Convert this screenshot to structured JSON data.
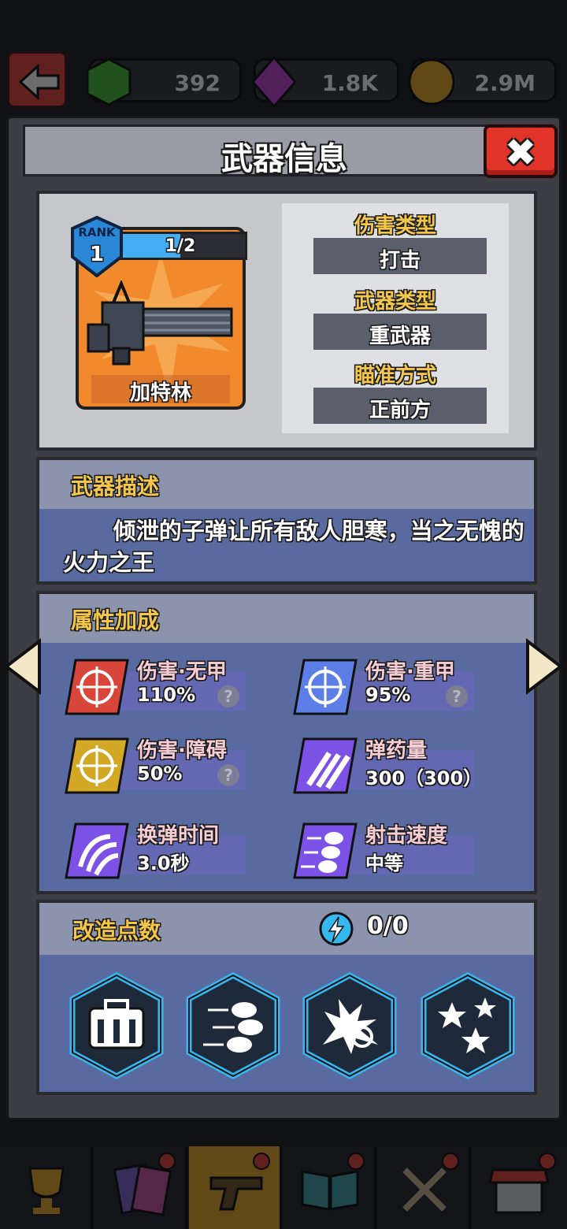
{
  "topbar": {
    "gems_green": "392",
    "gems_purple": "1.8K",
    "coins": "2.9M"
  },
  "header": {
    "title": "武器信息",
    "close_symbol": "✖"
  },
  "weapon": {
    "rank_word": "RANK",
    "rank": "1",
    "rank_progress_text": "1/2",
    "rank_progress_fraction": 0.5,
    "name": "加特林"
  },
  "info": {
    "damage_type_label": "伤害类型",
    "damage_type": "打击",
    "weapon_type_label": "武器类型",
    "weapon_type": "重武器",
    "aim_label": "瞄准方式",
    "aim": "正前方"
  },
  "description": {
    "title": "武器描述",
    "text": "倾泄的子弹让所有敌人胆寒，当之无愧的火力之王"
  },
  "attributes": {
    "title": "属性加成",
    "items": [
      {
        "name": "伤害·无甲",
        "value": "110%",
        "help": "?"
      },
      {
        "name": "伤害·重甲",
        "value": "95%",
        "help": "?"
      },
      {
        "name": "伤害·障碍",
        "value": "50%",
        "help": "?"
      },
      {
        "name": "弹药量",
        "value": "300（300）"
      },
      {
        "name": "换弹时间",
        "value": "3.0秒"
      },
      {
        "name": "射击速度",
        "value": "中等"
      }
    ]
  },
  "modification": {
    "title": "改造点数",
    "points": "0/0",
    "slots": [
      "ammo-box-icon",
      "speed-bullets-icon",
      "explosion-icon",
      "stars-icon"
    ]
  },
  "colors": {
    "accent_yellow": "#f4c64a",
    "panel_blue": "#586aa0",
    "close_red": "#e0342b",
    "card_orange": "#f08a2c"
  }
}
